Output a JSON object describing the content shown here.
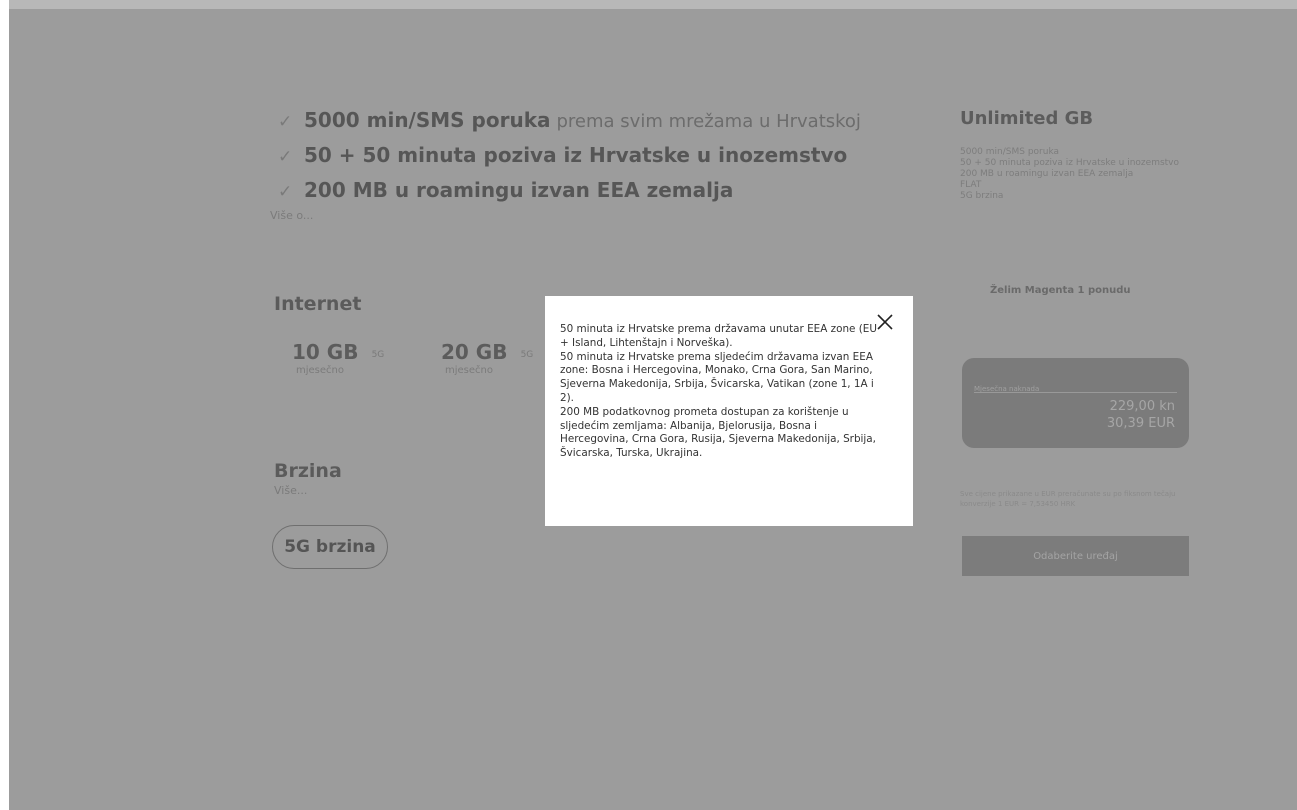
{
  "features": [
    {
      "bold": "5000 min/SMS poruka",
      "light": "prema svim mrežama u Hrvatskoj"
    },
    {
      "bold": "50 + 50 minuta poziva iz Hrvatske u inozemstvo",
      "light": ""
    },
    {
      "bold": "200 MB u roamingu izvan EEA zemalja",
      "light": ""
    }
  ],
  "features_more": "Više o...",
  "internet": {
    "title": "Internet",
    "packages": [
      {
        "amount": "10 GB",
        "network": "5G",
        "period": "mjesečno"
      },
      {
        "amount": "20 GB",
        "network": "5G",
        "period": "mjesečno"
      }
    ]
  },
  "brzina": {
    "title": "Brzina",
    "more": "Više...",
    "option": "5G brzina"
  },
  "sidebar": {
    "title": "Unlimited GB",
    "lines": [
      "5000 min/SMS poruka",
      "50 + 50 minuta poziva iz Hrvatske u inozemstvo",
      "200 MB u roamingu izvan EEA zemalja",
      "FLAT",
      "5G brzina"
    ],
    "cta": "Želim Magenta 1 ponudu",
    "price_label": "Mjesečna naknada",
    "price_hrk": "229,00 kn",
    "price_eur": "30,39 EUR",
    "note": "Sve cijene prikazane u EUR preračunate su po fiksnom tečaju konverzije 1 EUR = 7,53450 HRK",
    "order_button": "Odaberite uređaj"
  },
  "modal": {
    "text": "50 minuta iz Hrvatske prema državama unutar EEA zone (EU + Island, Lihtenštajn i Norveška).\n50 minuta iz Hrvatske prema sljedećim državama izvan EEA zone: Bosna i Hercegovina, Monako, Crna Gora, San Marino, Sjeverna Makedonija, Srbija, Švicarska, Vatikan (zone 1, 1A i 2).\n200 MB podatkovnog prometa dostupan za korištenje u sljedećim zemljama: Albanija, Bjelorusija, Bosna i Hercegovina, Crna Gora, Rusija, Sjeverna Makedonija, Srbija, Švicarska, Turska, Ukrajina.",
    "close_icon": "close-icon"
  }
}
